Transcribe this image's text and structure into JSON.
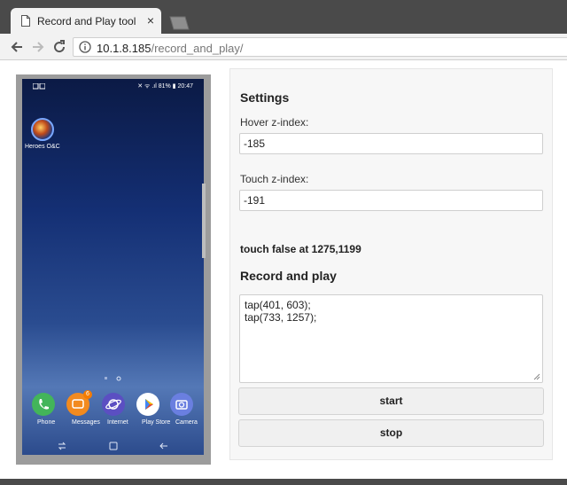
{
  "browser": {
    "tab_title": "Record and Play tool",
    "tab_close": "×",
    "url_host": "10.1.8.185",
    "url_path": "/record_and_play/"
  },
  "phone": {
    "status_right": "✕ ᯤ .ıl 81% ▮ 20:47",
    "home_app": {
      "label": "Heroes O&C",
      "icon": "game-icon"
    },
    "dock": [
      {
        "label": "Phone",
        "icon": "phone-icon",
        "color": "#43b55a"
      },
      {
        "label": "Messages",
        "icon": "messages-icon",
        "color": "#f28a1f",
        "badge": "6"
      },
      {
        "label": "Internet",
        "icon": "internet-icon",
        "color": "#5b4fc2"
      },
      {
        "label": "Play Store",
        "icon": "play-store-icon",
        "color": "#ffffff"
      },
      {
        "label": "Camera",
        "icon": "camera-icon",
        "color": "#6a7fe0"
      }
    ]
  },
  "settings": {
    "heading": "Settings",
    "hover_label": "Hover z-index:",
    "hover_value": "-185",
    "touch_label": "Touch z-index:",
    "touch_value": "-191",
    "touch_status": "touch false at 1275,1199"
  },
  "record": {
    "heading": "Record and play",
    "line1": "tap(401, 603);",
    "line2": "tap(733, 1257);",
    "start_label": "start",
    "stop_label": "stop"
  }
}
